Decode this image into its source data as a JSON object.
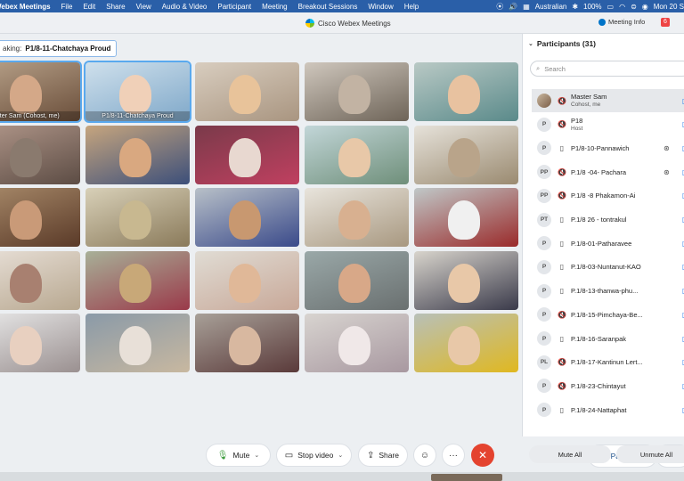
{
  "menubar": {
    "app": "Webex Meetings",
    "items": [
      "File",
      "Edit",
      "Share",
      "View",
      "Audio & Video",
      "Participant",
      "Meeting",
      "Breakout Sessions",
      "Window",
      "Help"
    ],
    "battery": "100%",
    "input_source": "Australian",
    "clock": "Mon 20 S"
  },
  "window": {
    "title": "Cisco Webex Meetings",
    "meeting_info": "Meeting Info",
    "notification_count": "6"
  },
  "speaking": {
    "prefix": "aking:",
    "name": "P1/8-11-Chatchaya Proud"
  },
  "tiles": [
    {
      "label": "ster Sam (Cohost, me)",
      "colors": [
        "#b8a28a",
        "#6a4e3a"
      ],
      "fig": "#d4a888",
      "active": true
    },
    {
      "label": "P1/8-11-Chatchaya Proud",
      "colors": [
        "#cfe0ec",
        "#7fa8c9"
      ],
      "fig": "#f0d0b8",
      "active": true
    },
    {
      "label": "",
      "colors": [
        "#d8cdbf",
        "#a99580"
      ],
      "fig": "#e8c39a"
    },
    {
      "label": "",
      "colors": [
        "#cfc7bd",
        "#6e6458"
      ],
      "fig": "#c2b3a3"
    },
    {
      "label": "",
      "colors": [
        "#b9c9c5",
        "#5a8a8a"
      ],
      "fig": "#e8c2a0"
    },
    {
      "label": "",
      "colors": [
        "#b1978a",
        "#5c4c44"
      ],
      "fig": "#8a7a6e"
    },
    {
      "label": "",
      "colors": [
        "#c6a57e",
        "#3c4f7a"
      ],
      "fig": "#d9a880"
    },
    {
      "label": "",
      "colors": [
        "#7a3a4a",
        "#c04060"
      ],
      "fig": "#e8d8d0"
    },
    {
      "label": "",
      "colors": [
        "#c2d6d8",
        "#6f8f7a"
      ],
      "fig": "#e8c8a8"
    },
    {
      "label": "",
      "colors": [
        "#e6e2da",
        "#9a8a70"
      ],
      "fig": "#b9a48a"
    },
    {
      "label": "",
      "colors": [
        "#a88a6a",
        "#5a3a28"
      ],
      "fig": "#c99a78"
    },
    {
      "label": "",
      "colors": [
        "#d8d0b8",
        "#8a7a5a"
      ],
      "fig": "#c8b890"
    },
    {
      "label": "",
      "colors": [
        "#b8c0c8",
        "#3a4a8a"
      ],
      "fig": "#c89870"
    },
    {
      "label": "",
      "colors": [
        "#e8e4dc",
        "#a89880"
      ],
      "fig": "#d8b090"
    },
    {
      "label": "",
      "colors": [
        "#c0c8c8",
        "#9a2a2a"
      ],
      "fig": "#f0f0f0"
    },
    {
      "label": "",
      "colors": [
        "#e8e0d8",
        "#b8a890"
      ],
      "fig": "#a88070"
    },
    {
      "label": "",
      "colors": [
        "#a8b098",
        "#9a3a4a"
      ],
      "fig": "#c8a878"
    },
    {
      "label": "",
      "colors": [
        "#e0dcd4",
        "#c8a898"
      ],
      "fig": "#e0b898"
    },
    {
      "label": "",
      "colors": [
        "#9aa8a8",
        "#6a7070"
      ],
      "fig": "#d8a888"
    },
    {
      "label": "",
      "colors": [
        "#d8d4cc",
        "#3a3a4a"
      ],
      "fig": "#e8c8a8"
    },
    {
      "label": "",
      "colors": [
        "#e8e8e8",
        "#9a9090"
      ],
      "fig": "#e8d0c0"
    },
    {
      "label": "",
      "colors": [
        "#8a9aa8",
        "#c8b8a0"
      ],
      "fig": "#e8e0d8"
    },
    {
      "label": "",
      "colors": [
        "#a8a098",
        "#5a3a3a"
      ],
      "fig": "#d8b8a0"
    },
    {
      "label": "",
      "colors": [
        "#d8d4d0",
        "#a898a0"
      ],
      "fig": "#f0e8e8"
    },
    {
      "label": "",
      "colors": [
        "#b8c0b8",
        "#e0b820"
      ],
      "fig": "#e8c8a8"
    }
  ],
  "controls": {
    "mute": "Mute",
    "stop_video": "Stop video",
    "share": "Share",
    "participants": "Participants",
    "chat": "Ch"
  },
  "panel": {
    "title": "Participants (31)",
    "search_placeholder": "Search",
    "mute_all": "Mute All",
    "unmute_all": "Unmute All",
    "participants": [
      {
        "initials": "",
        "photo": true,
        "name": "Master Sam",
        "sub": "Cohost, me",
        "device": "🔇",
        "share": false
      },
      {
        "initials": "P",
        "name": "P18",
        "sub": "Host",
        "device": "🔇",
        "share": false
      },
      {
        "initials": "P",
        "name": "P1/8-10-Pannawich",
        "device": "▯",
        "share": true
      },
      {
        "initials": "PP",
        "name": "P.1/8 -04- Pachara",
        "device": "🔇",
        "share": true
      },
      {
        "initials": "PP",
        "name": "P.1/8 -8 Phakamon-Ai",
        "device": "🔇",
        "share": false
      },
      {
        "initials": "PT",
        "name": "P.1/8 26 - tontrakul",
        "device": "▯",
        "share": false
      },
      {
        "initials": "P",
        "name": "P.1/8-01-Patharavee",
        "device": "▯",
        "share": false
      },
      {
        "initials": "P",
        "name": "P.1/8-03-Nuntanut-KAO",
        "device": "▯",
        "share": false
      },
      {
        "initials": "P",
        "name": "P.1/8-13-thanwa-phu...",
        "device": "▯",
        "share": false
      },
      {
        "initials": "P",
        "name": "P.1/8-15-Pimchaya-Be...",
        "device": "🔇",
        "share": false
      },
      {
        "initials": "P",
        "name": "P.1/8-16-Saranpak",
        "device": "▯",
        "share": false
      },
      {
        "initials": "PL",
        "name": "P.1/8-17-Kantinun Lert...",
        "device": "🔇",
        "share": false
      },
      {
        "initials": "P",
        "name": "P.1/8-23-Chintayut",
        "device": "🔇",
        "share": false
      },
      {
        "initials": "P",
        "name": "P.1/8-24-Nattaphat",
        "device": "▯",
        "share": false
      }
    ]
  }
}
